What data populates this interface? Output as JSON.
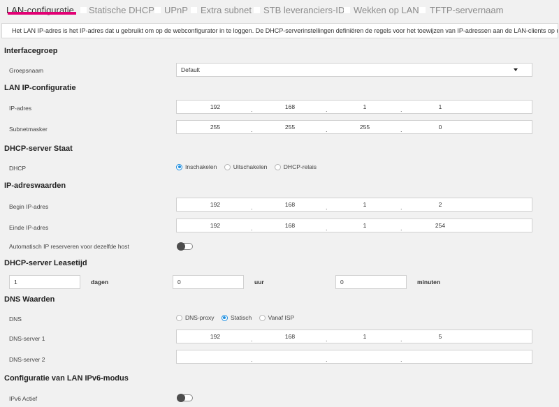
{
  "tabs": [
    {
      "label": "LAN-configuratie",
      "active": true
    },
    {
      "label": "Statische DHCP"
    },
    {
      "label": "UPnP"
    },
    {
      "label": "Extra subnet"
    },
    {
      "label": "STB leveranciers-ID"
    },
    {
      "label": "Wekken op LAN"
    },
    {
      "label": "TFTP-servernaam"
    }
  ],
  "info_text": "Het LAN IP-adres is het IP-adres dat u gebruikt om op de webconfigurator in te loggen. De DHCP-serverinstellingen definiëren de regels voor het toewijzen van IP-adressen aan de LAN-clients op uw netwerk.",
  "interface_group": {
    "title": "Interfacegroep",
    "label": "Groepsnaam",
    "value": "Default"
  },
  "lan_ip": {
    "title": "LAN IP-configuratie",
    "ip_label": "IP-adres",
    "ip": [
      "192",
      "168",
      "1",
      "1"
    ],
    "mask_label": "Subnetmasker",
    "mask": [
      "255",
      "255",
      "255",
      "0"
    ]
  },
  "dhcp_state": {
    "title": "DHCP-server Staat",
    "label": "DHCP",
    "options": [
      "Inschakelen",
      "Uitschakelen",
      "DHCP-relais"
    ],
    "selected": "Inschakelen"
  },
  "ip_range": {
    "title": "IP-adreswaarden",
    "begin_label": "Begin IP-adres",
    "begin": [
      "192",
      "168",
      "1",
      "2"
    ],
    "end_label": "Einde IP-adres",
    "end": [
      "192",
      "168",
      "1",
      "254"
    ],
    "reserve_label": "Automatisch IP reserveren voor dezelfde host",
    "reserve_on": false
  },
  "lease": {
    "title": "DHCP-server Leasetijd",
    "days": "1",
    "days_unit": "dagen",
    "hours": "0",
    "hours_unit": "uur",
    "minutes": "0",
    "minutes_unit": "minuten"
  },
  "dns": {
    "title": "DNS Waarden",
    "label": "DNS",
    "options": [
      "DNS-proxy",
      "Statisch",
      "Vanaf ISP"
    ],
    "selected": "Statisch",
    "server1_label": "DNS-server 1",
    "server1": [
      "192",
      "168",
      "1",
      "5"
    ],
    "server2_label": "DNS-server 2",
    "server2": [
      "",
      "",
      "",
      ""
    ]
  },
  "ipv6": {
    "title": "Configuratie van LAN IPv6-modus",
    "label": "IPv6 Actief",
    "on": false
  },
  "colors": {
    "accent": "#e20074",
    "radio": "#1f8fe0"
  }
}
